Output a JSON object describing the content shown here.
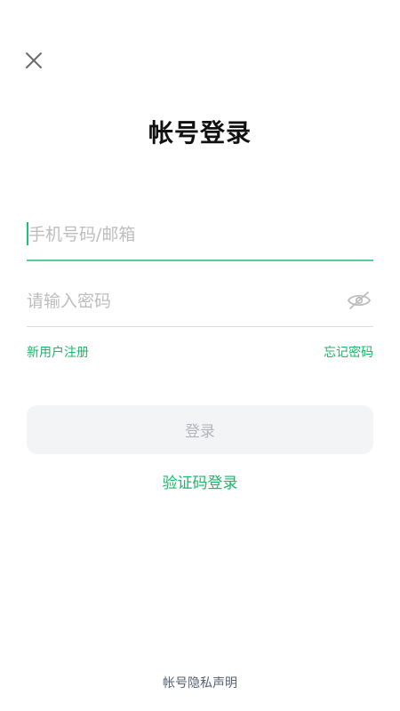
{
  "header": {
    "close_icon": "close-icon"
  },
  "page": {
    "title": "帐号登录"
  },
  "form": {
    "account_placeholder": "手机号码/邮箱",
    "account_value": "",
    "password_placeholder": "请输入密码",
    "password_value": "",
    "password_toggle_icon": "eye-hidden-icon"
  },
  "links": {
    "register": "新用户注册",
    "forgot_password": "忘记密码"
  },
  "actions": {
    "login": "登录",
    "code_login": "验证码登录"
  },
  "footer": {
    "privacy": "帐号隐私声明"
  },
  "colors": {
    "accent": "#1fb36b",
    "focus_line": "#4fcf9a",
    "button_bg": "#f3f4f6",
    "button_text": "#b3b6bb",
    "placeholder": "#bdbdbd"
  }
}
